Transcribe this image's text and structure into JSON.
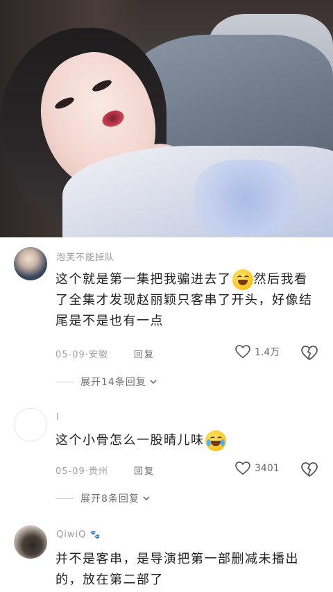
{
  "video": {
    "description_icon": "video-frame"
  },
  "comments": [
    {
      "username": "泡芙不能掉队",
      "text_lines": [
        "这个就是第一集把我骗进去了",
        "然后我看",
        "了全集才发现赵丽颖只客串了开头，好像结",
        "尾是不是也有一点"
      ],
      "date": "05-09",
      "location": "安徽",
      "reply_label": "回复",
      "likes": "1.4万",
      "expand_label": "展开14条回复"
    },
    {
      "username": "l",
      "text": "这个小骨怎么一股晴儿味",
      "date": "05-09",
      "location": "贵州",
      "reply_label": "回复",
      "likes": "3401",
      "expand_label": "展开8条回复"
    },
    {
      "username": "QiwiQ",
      "text_lines": [
        "并不是客串，是导演把第一部删减未播出",
        "的，放在第二部了"
      ]
    }
  ],
  "colors": {
    "text_primary": "#1f1f1f",
    "text_secondary": "#a0a0a0",
    "divider": "#cfcfcf"
  }
}
